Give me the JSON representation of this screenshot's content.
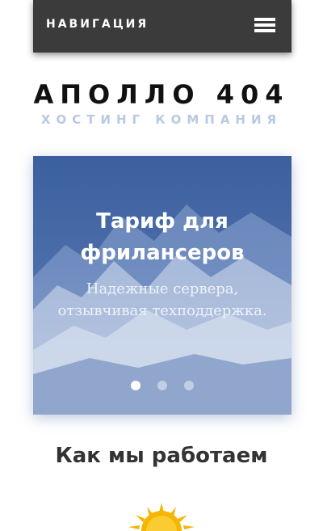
{
  "navbar": {
    "title": "НАВИГАЦИЯ",
    "menu_icon": "hamburger-menu-icon"
  },
  "brand": {
    "title": "АПОЛЛО 404",
    "subtitle": "ХОСТИНГ КОМПАНИЯ"
  },
  "slider": {
    "title_line1": "Тариф для",
    "title_line2": "фрилансеров",
    "text_line1": "Надежные сервера,",
    "text_line2": "отзывчивая техподдержка.",
    "slide_count": 3,
    "active_slide": 1
  },
  "section": {
    "title": "Как мы работаем",
    "icon": "sun-icon"
  },
  "colors": {
    "navbar_bg": "#3b3b3b",
    "subtitle": "#b9c8e3",
    "slider_tint": "#4c6eaa",
    "sun": "#f5b400"
  }
}
